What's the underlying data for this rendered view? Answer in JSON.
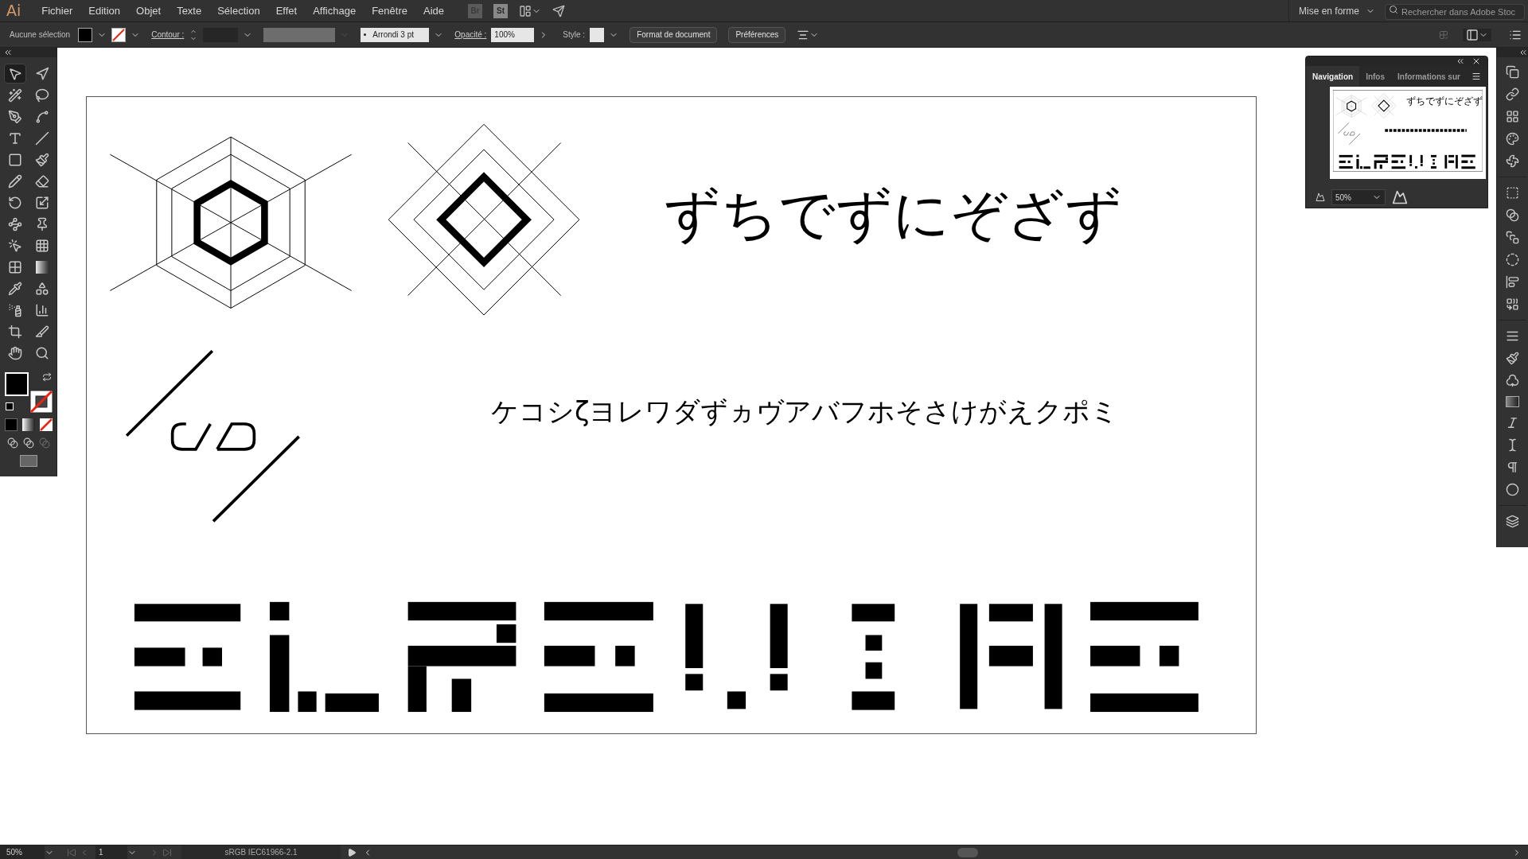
{
  "menu_bar": {
    "logo": "Ai",
    "menus": [
      "Fichier",
      "Edition",
      "Objet",
      "Texte",
      "Sélection",
      "Effet",
      "Affichage",
      "Fenêtre",
      "Aide"
    ],
    "app_buttons": [
      "Br",
      "St"
    ],
    "workspace": "Mise en forme",
    "search": {
      "placeholder": "Rechercher dans Adobe Stoc"
    }
  },
  "control_bar": {
    "selection": "Aucune sélection",
    "stroke_label": "Contour :",
    "brush": "Arrondi 3 pt",
    "opacity_label": "Opacité :",
    "opacity": "100%",
    "style_label": "Style :",
    "buttons": [
      "Format de document",
      "Préférences"
    ]
  },
  "tools": [
    {
      "selected": true
    },
    {
      "selected": false
    },
    {
      "selected": false
    },
    {
      "selected": false
    },
    {
      "selected": false
    },
    {
      "selected": false
    },
    {
      "selected": false
    },
    {
      "selected": false
    },
    {
      "selected": false
    },
    {
      "selected": false
    },
    {
      "selected": false
    },
    {
      "selected": false
    },
    {
      "selected": false
    },
    {
      "selected": false
    },
    {
      "selected": false
    },
    {
      "selected": false
    },
    {
      "selected": false
    },
    {
      "selected": false
    },
    {
      "selected": false
    },
    {
      "selected": false
    },
    {
      "selected": false
    },
    {
      "selected": false
    },
    {
      "selected": false
    },
    {
      "selected": false
    },
    {
      "selected": false
    },
    {
      "selected": false
    },
    {
      "selected": false
    },
    {
      "selected": false
    }
  ],
  "artboard": {
    "heading": "ずちでずにぞざず",
    "subline": "ケコシζヨレワダずヵヴアバフホそさけがえクポミ"
  },
  "navigator": {
    "tabs": [
      {
        "label": "Navigation",
        "selected": true
      },
      {
        "label": "Infos",
        "selected": false
      },
      {
        "label": "Informations sur",
        "selected": false
      }
    ],
    "thumbnail_heading": "ずちでずにぞざず",
    "zoom": "50%"
  },
  "status_bar": {
    "zoom": "50%",
    "artboard": "1",
    "profile": "sRGB IEC61966-2.1"
  }
}
